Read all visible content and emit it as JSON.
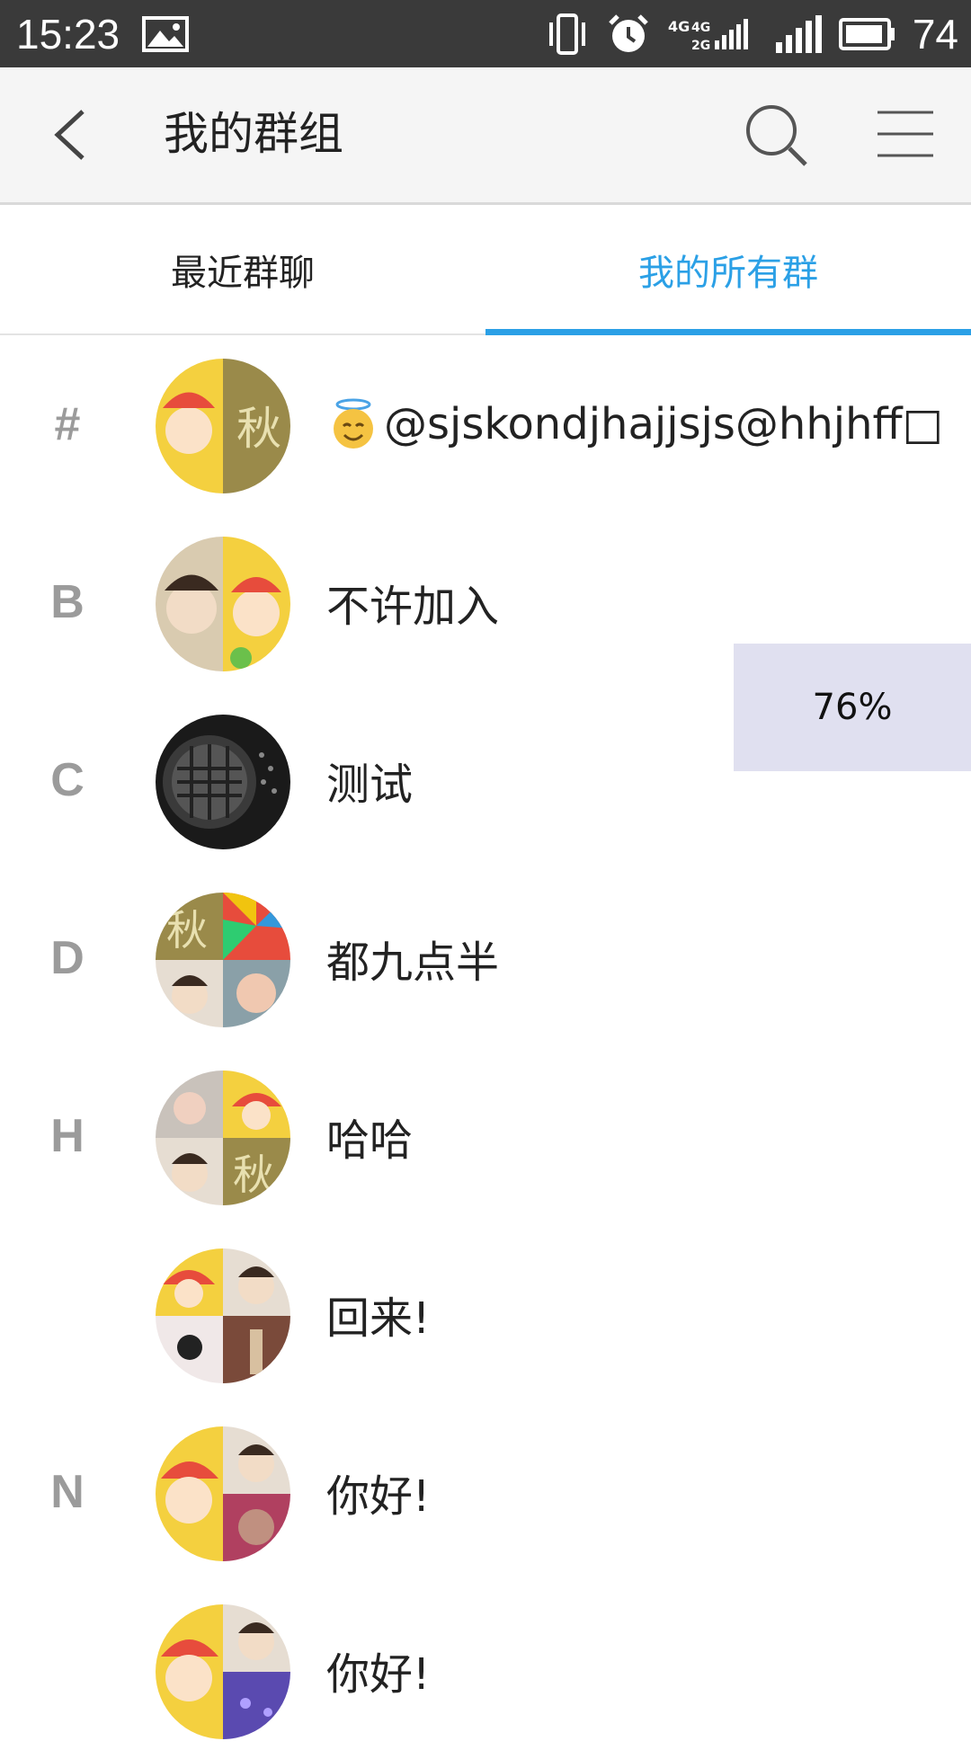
{
  "status_bar": {
    "time": "15:23",
    "battery": "74",
    "icons": [
      "gallery-icon",
      "vibrate-icon",
      "alarm-icon",
      "network-4g-icon",
      "signal-icon",
      "battery-icon"
    ]
  },
  "app_bar": {
    "title": "我的群组",
    "icons": [
      "back-arrow-icon",
      "search-icon",
      "menu-icon"
    ]
  },
  "tabs": [
    {
      "label": "最近群聊",
      "active": false
    },
    {
      "label": "我的所有群",
      "active": true
    }
  ],
  "accent_color": "#2ba0e6",
  "groups": [
    {
      "letter": "#",
      "name": "@sjskondjhajjsjs@hhjhff□",
      "has_emoji": true
    },
    {
      "letter": "B",
      "name": "不许加入"
    },
    {
      "letter": "C",
      "name": "测试"
    },
    {
      "letter": "D",
      "name": "都九点半"
    },
    {
      "letter": "H",
      "name": "哈哈"
    },
    {
      "letter": "",
      "name": "回来!"
    },
    {
      "letter": "N",
      "name": "你好!"
    },
    {
      "letter": "",
      "name": "你好!"
    }
  ],
  "progress_overlay": {
    "text": "76%"
  }
}
